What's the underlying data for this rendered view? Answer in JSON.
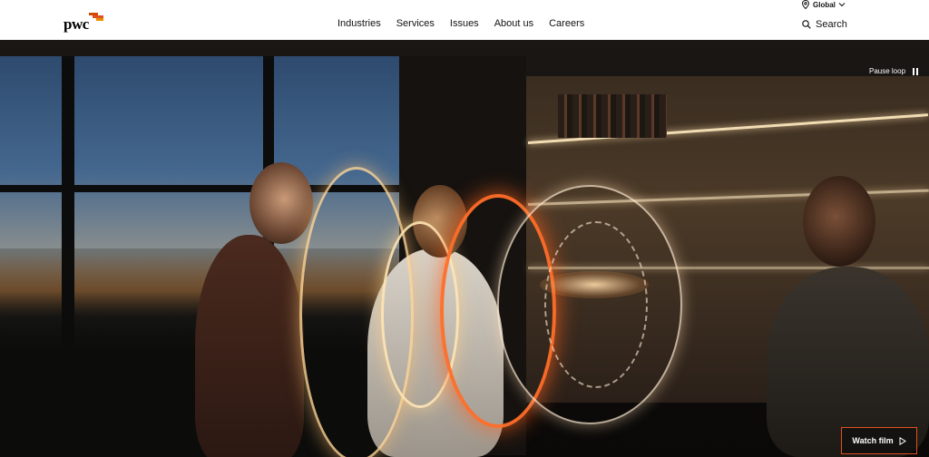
{
  "header": {
    "logo_text": "pwc",
    "nav": [
      "Industries",
      "Services",
      "Issues",
      "About us",
      "Careers"
    ],
    "region_label": "Global",
    "search_label": "Search"
  },
  "hero": {
    "pause_label": "Pause loop",
    "watch_label": "Watch film"
  },
  "colors": {
    "accent": "#e0501f",
    "logo_orange": "#e0501f",
    "logo_red": "#d04a02"
  }
}
